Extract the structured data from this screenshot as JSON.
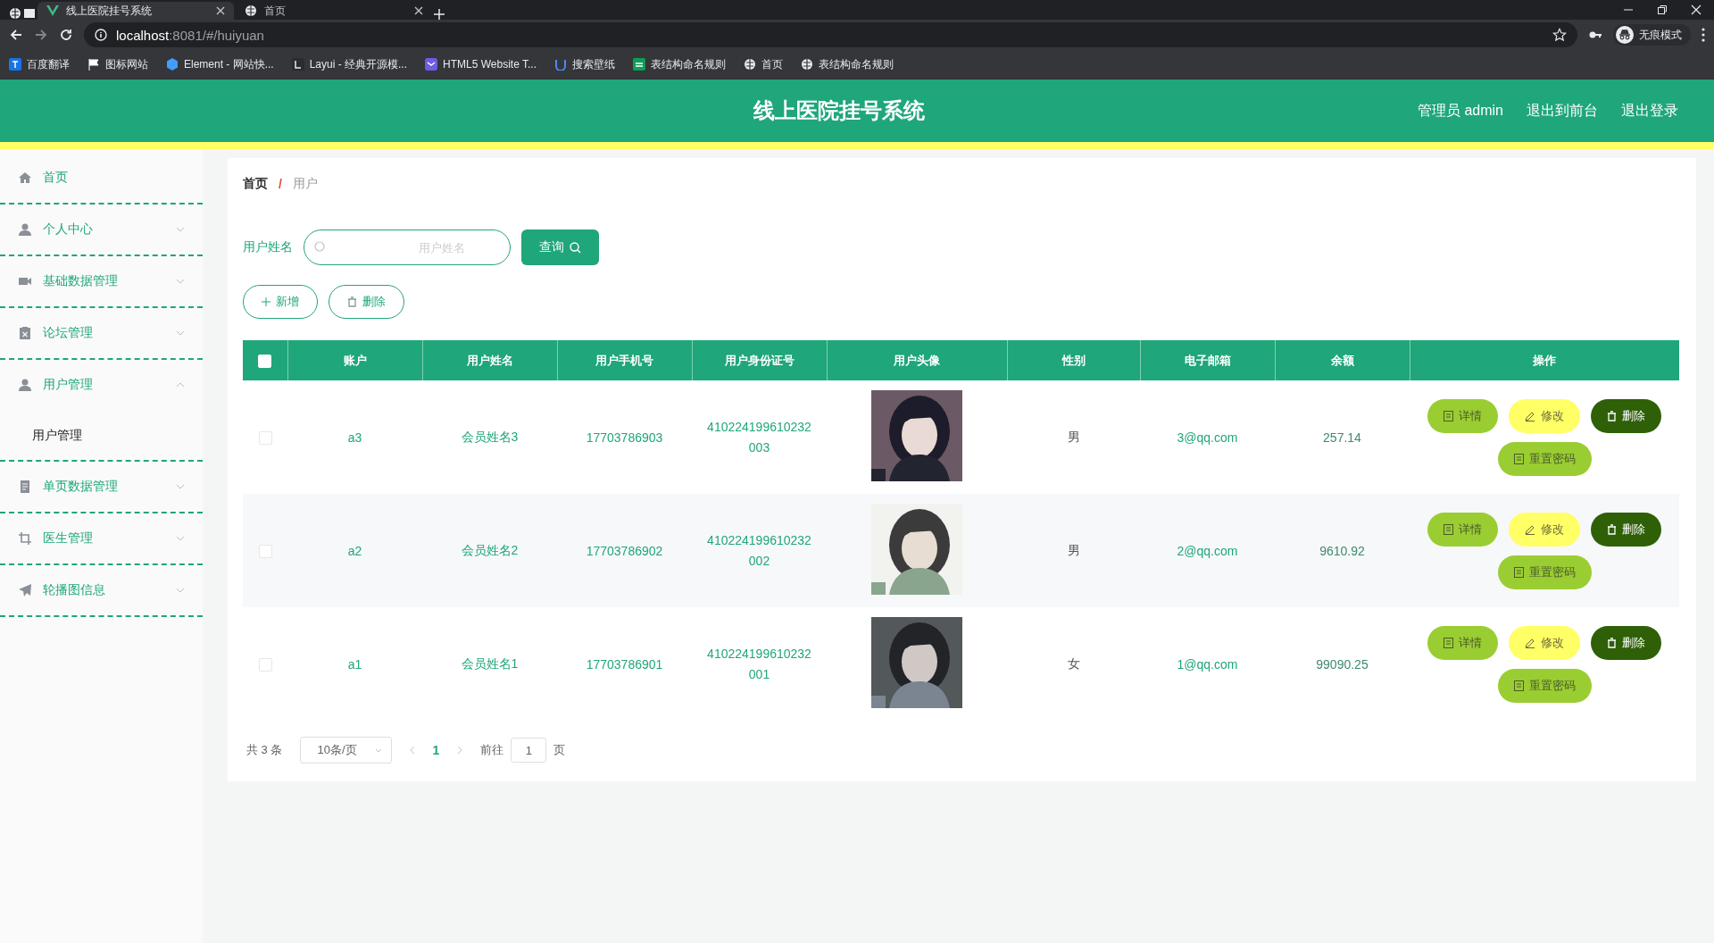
{
  "browser": {
    "tabs": [
      {
        "title": "线上医院挂号系统",
        "selected": true
      },
      {
        "title": "首页",
        "selected": false
      }
    ],
    "url": {
      "host": "localhost",
      "path": ":8081/#/huiyuan"
    },
    "profile": "无痕模式",
    "bookmarks": [
      "百度翻译",
      "图标网站",
      "Element - 网站快...",
      "Layui - 经典开源模...",
      "HTML5 Website T...",
      "搜索壁纸",
      "表结构命名规则",
      "首页",
      "表结构命名规则"
    ]
  },
  "header": {
    "title": "线上医院挂号系统",
    "user": "管理员 admin",
    "links": [
      "退出到前台",
      "退出登录"
    ]
  },
  "sidebar": {
    "items": [
      {
        "label": "首页",
        "kind": "link"
      },
      {
        "label": "个人中心",
        "kind": "menu",
        "expanded": false
      },
      {
        "label": "基础数据管理",
        "kind": "menu",
        "expanded": false
      },
      {
        "label": "论坛管理",
        "kind": "menu",
        "expanded": false
      },
      {
        "label": "用户管理",
        "kind": "menu",
        "expanded": true,
        "children": [
          {
            "label": "用户管理"
          }
        ]
      },
      {
        "label": "单页数据管理",
        "kind": "menu",
        "expanded": false
      },
      {
        "label": "医生管理",
        "kind": "menu",
        "expanded": false
      },
      {
        "label": "轮播图信息",
        "kind": "menu",
        "expanded": false
      }
    ]
  },
  "breadcrumb": {
    "items": [
      "首页",
      "用户"
    ],
    "separator": "/"
  },
  "search": {
    "label": "用户姓名",
    "placeholder": "用户姓名",
    "button": "查询"
  },
  "toolbar": [
    {
      "kind": "add",
      "label": "新增"
    },
    {
      "kind": "delete",
      "label": "删除"
    }
  ],
  "table": {
    "header_checked": false,
    "columns": [
      "账户",
      "用户姓名",
      "用户手机号",
      "用户身份证号",
      "用户头像",
      "性别",
      "电子邮箱",
      "余额",
      "操作"
    ],
    "rows": [
      {
        "checked": false,
        "account": "a3",
        "name": "会员姓名3",
        "phone": "17703786903",
        "id_card": "410224199610232003",
        "gender": "男",
        "email": "3@qq.com",
        "balance": "257.14",
        "actions": [
          {
            "kind": "detail",
            "label": "详情"
          },
          {
            "kind": "edit",
            "label": "修改"
          },
          {
            "kind": "delete",
            "label": "删除"
          },
          {
            "kind": "reset",
            "label": "重置密码"
          }
        ]
      },
      {
        "checked": false,
        "account": "a2",
        "name": "会员姓名2",
        "phone": "17703786902",
        "id_card": "410224199610232002",
        "gender": "男",
        "email": "2@qq.com",
        "balance": "9610.92",
        "actions": [
          {
            "kind": "detail",
            "label": "详情"
          },
          {
            "kind": "edit",
            "label": "修改"
          },
          {
            "kind": "delete",
            "label": "删除"
          },
          {
            "kind": "reset",
            "label": "重置密码"
          }
        ]
      },
      {
        "checked": false,
        "account": "a1",
        "name": "会员姓名1",
        "phone": "17703786901",
        "id_card": "410224199610232001",
        "gender": "女",
        "email": "1@qq.com",
        "balance": "99090.25",
        "actions": [
          {
            "kind": "detail",
            "label": "详情"
          },
          {
            "kind": "edit",
            "label": "修改"
          },
          {
            "kind": "delete",
            "label": "删除"
          },
          {
            "kind": "reset",
            "label": "重置密码"
          }
        ]
      }
    ]
  },
  "pagination": {
    "total": "共 3 条",
    "page_size": "10条/页",
    "pages": [
      {
        "label": "1",
        "selected": true
      }
    ],
    "goto_label": "前往",
    "goto_value": "1",
    "goto_suffix": "页"
  }
}
